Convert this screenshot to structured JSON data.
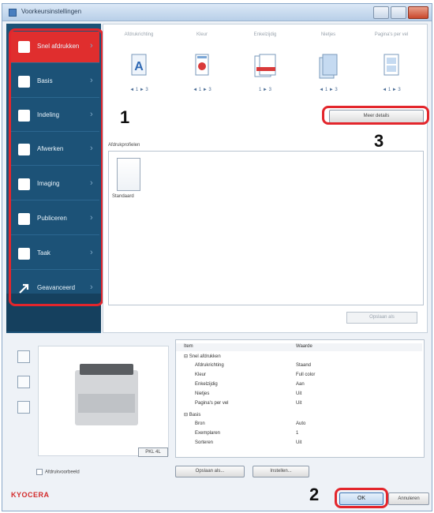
{
  "window": {
    "title": "Voorkeursinstellingen"
  },
  "sidebar": {
    "items": [
      {
        "label": "Snel afdrukken"
      },
      {
        "label": "Basis"
      },
      {
        "label": "Indeling"
      },
      {
        "label": "Afwerken"
      },
      {
        "label": "Imaging"
      },
      {
        "label": "Publiceren"
      },
      {
        "label": "Taak"
      },
      {
        "label": "Geavanceerd"
      }
    ]
  },
  "thumbnails": [
    {
      "heading": "Afdrukrichting",
      "sub": "◄ 1 ► 3"
    },
    {
      "heading": "Kleur",
      "sub": "◄ 1 ► 3"
    },
    {
      "heading": "Enkelzijdig",
      "sub": "1 ► 3"
    },
    {
      "heading": "Nietjes",
      "sub": "◄ 1 ► 3"
    },
    {
      "heading": "Pagina's per vel",
      "sub": "◄ 1 ► 3"
    }
  ],
  "more_button": "Meer details",
  "profile_section_label": "Afdrukprofielen",
  "profile_card_name": "Standaard",
  "save_button": "Opslaan als",
  "tools": {
    "icons": [
      "printer-icon",
      "document-icon",
      "settings-icon"
    ]
  },
  "model_tag": "PKL 4L",
  "table": {
    "headers": [
      "Item",
      "Waarde"
    ],
    "rows": [
      [
        "⊟ Snel afdrukken",
        ""
      ],
      [
        "Afdrukrichting",
        "Staand"
      ],
      [
        "Kleur",
        "Full color"
      ],
      [
        "Enkelzijdig",
        "Aan"
      ],
      [
        "Nietjes",
        "Uit"
      ],
      [
        "Pagina's per vel",
        "Uit"
      ],
      [
        "⊟ Basis",
        ""
      ],
      [
        "Bron",
        "Auto"
      ],
      [
        "Exemplaren",
        "1"
      ],
      [
        "Sorteren",
        "Uit"
      ]
    ]
  },
  "checkbox_label": "Afdrukvoorbeeld",
  "bottom_buttons": [
    "Opslaan als...",
    "Instellen..."
  ],
  "footer": {
    "logo": "KYOCERA",
    "ok": "OK",
    "cancel": "Annuleren"
  },
  "callouts": [
    "1",
    "2",
    "3"
  ]
}
